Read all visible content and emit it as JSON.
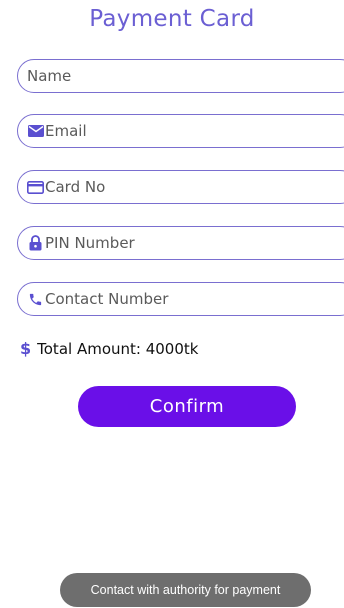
{
  "header": {
    "title": "Payment Card"
  },
  "form": {
    "name": {
      "placeholder": "Name",
      "value": ""
    },
    "email": {
      "placeholder": "Email",
      "value": "",
      "icon": "envelope-icon"
    },
    "card": {
      "placeholder": "Card No",
      "value": "",
      "icon": "credit-card-icon"
    },
    "pin": {
      "placeholder": "PIN Number",
      "value": "",
      "icon": "lock-icon"
    },
    "contact": {
      "placeholder": "Contact Number",
      "value": "",
      "icon": "phone-icon"
    }
  },
  "total": {
    "icon": "dollar-icon",
    "symbol": "$",
    "label": "Total Amount: 4000tk"
  },
  "actions": {
    "confirm_label": "Confirm"
  },
  "toast": {
    "message": "Contact with authority for payment"
  },
  "colors": {
    "accent": "#6b5fd3",
    "button": "#6a0fe8",
    "toast": "#6e6e6e"
  }
}
